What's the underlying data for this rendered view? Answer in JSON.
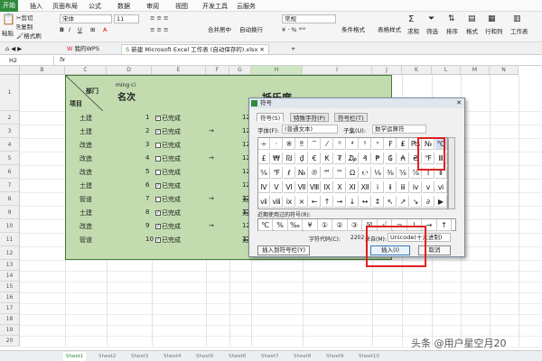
{
  "ribbon_tabs": [
    "开始",
    "插入",
    "页面布局",
    "公式",
    "数据",
    "审阅",
    "视图",
    "开发工具",
    "云服务"
  ],
  "toolbar": {
    "paste": "粘贴",
    "cut": "剪切",
    "copy": "复制",
    "format_painter": "格式刷",
    "font_name": "宋体",
    "font_size": "11",
    "merge_center": "合并居中",
    "wrap": "自动换行",
    "number_format": "常规",
    "cond_format": "条件格式",
    "table_style": "表格样式",
    "sum": "求和",
    "filter": "筛选",
    "sort": "排序",
    "format": "格式",
    "rows_cols": "行和列",
    "worksheet": "工作表"
  },
  "doc_tabs": [
    "我的WPS",
    "新建 Microsoft Excel 工作表 (自动保存的).xlsx"
  ],
  "name_box": "H2",
  "formula_fx": "fx",
  "columns": [
    "B",
    "C",
    "D",
    "E",
    "F",
    "G",
    "H",
    "I",
    "J",
    "K",
    "L",
    "M",
    "N"
  ],
  "rows": [
    "1",
    "2",
    "3",
    "4",
    "5",
    "6",
    "7",
    "8",
    "9",
    "10",
    "11",
    "12",
    "13",
    "14",
    "15",
    "16",
    "17",
    "18",
    "19",
    "20",
    "21",
    "22",
    "23"
  ],
  "sheet": {
    "header_dept": "部门",
    "header_item": "项目",
    "pinyin": "ming ci",
    "header_rank": "名次",
    "header_partial": "抵乐度",
    "depts": [
      "土建",
      "土建",
      "改造",
      "改造",
      "改造",
      "土建",
      "管道",
      "土建",
      "改造",
      "管道"
    ],
    "ranks": [
      "1",
      "2",
      "3",
      "4",
      "5",
      "6",
      "7",
      "8",
      "9",
      "10"
    ],
    "done_label": "已完成",
    "checked": [
      true,
      true,
      false,
      false,
      false,
      true,
      false,
      true,
      true,
      true
    ],
    "arrows": [
      "→",
      "→",
      "→",
      "→"
    ],
    "g_values": [
      "12",
      "12",
      "12",
      "12",
      "12",
      "12",
      "12",
      "12",
      "12",
      "12"
    ],
    "h_partial": [
      "无",
      "无",
      "无"
    ]
  },
  "dialog": {
    "title": "符号",
    "tabs": [
      "符号(S)",
      "特殊字符(P)",
      "符号栏(T)"
    ],
    "font_label": "字体(F):",
    "font_value": "(普通文本)",
    "subset_label": "子集(U):",
    "subset_value": "数学运算符",
    "symbols": [
      "÷",
      "·",
      "※",
      "‼",
      "‾",
      "⁄",
      "⁰",
      "⁴",
      "⁵",
      "ⁿ",
      "₣",
      "₤",
      "₧",
      "№",
      "℃",
      "£",
      "₩",
      "₪",
      "₫",
      "€",
      "₭",
      "₮",
      "₯",
      "₰",
      "₱",
      "₲",
      "₳",
      "₴",
      "℉",
      "Ⅲ",
      "⅝",
      "℉",
      "ℓ",
      "№",
      "℗",
      "℠",
      "™",
      "Ω",
      "℮",
      "⅛",
      "⅜",
      "⅝",
      "⅞",
      "Ⅰ",
      "Ⅱ",
      "Ⅳ",
      "Ⅴ",
      "Ⅵ",
      "Ⅶ",
      "Ⅷ",
      "Ⅸ",
      "Ⅹ",
      "Ⅺ",
      "Ⅻ",
      "ⅰ",
      "ⅱ",
      "ⅲ",
      "ⅳ",
      "ⅴ",
      "ⅵ",
      "ⅶ",
      "ⅷ",
      "ⅸ",
      "×",
      "←",
      "↑",
      "→",
      "↓",
      "↔",
      "↕",
      "↖",
      "↗",
      "↘",
      "∂",
      "▶"
    ],
    "recent_label": "近期使用过的符号(R):",
    "recent": [
      "℃",
      "%",
      "‰",
      "¥",
      "①",
      "②",
      "③",
      "☒",
      "√",
      "¬",
      "↓",
      "→",
      "↑"
    ],
    "char_code_label": "字符代码(C):",
    "char_code": "2202",
    "from_label": "来自(M):",
    "from_value": "Unicode(十六进制)",
    "insert_bar_button": "插入到符号栏(Y)",
    "insert_button": "插入(I)",
    "cancel_button": "取消"
  },
  "sheet_tabs": [
    "Sheet1",
    "Sheet2",
    "Sheet3",
    "Sheet4",
    "Sheet5",
    "Sheet6",
    "Sheet7",
    "Sheet8",
    "Sheet9",
    "Sheet10"
  ],
  "watermark": "头条 @用户星空月20",
  "colors": {
    "accent": "#2e8b3d",
    "sheet_fill": "#c2dcb0",
    "highlight": "#e02020"
  }
}
